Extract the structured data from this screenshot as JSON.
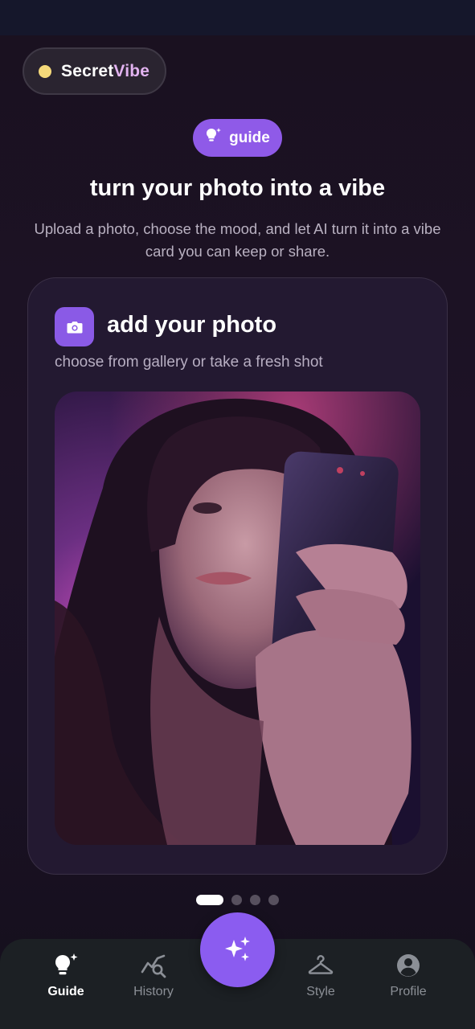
{
  "brand": {
    "part1": "Secret",
    "part2": "Vibe"
  },
  "guide_chip": {
    "label": "guide"
  },
  "hero": {
    "title": "turn your photo into a vibe",
    "subtitle": "Upload a photo, choose the mood, and let AI turn it into a vibe card you can keep or share."
  },
  "card": {
    "title": "add your photo",
    "subtitle": "choose from gallery or take a fresh shot"
  },
  "pager": {
    "count": 4,
    "active": 1
  },
  "nav": {
    "items": [
      {
        "label": "Guide",
        "icon": "lightbulb-sparkle-icon",
        "active": true
      },
      {
        "label": "History",
        "icon": "chart-search-icon",
        "active": false
      },
      {
        "label": "Style",
        "icon": "hanger-icon",
        "active": false
      },
      {
        "label": "Profile",
        "icon": "profile-icon",
        "active": false
      }
    ],
    "fab_icon": "sparkles-icon"
  },
  "colors": {
    "accent": "#8b5cf0",
    "brand_dot": "#f5d97a",
    "brand_highlight": "#e2b3f0"
  }
}
